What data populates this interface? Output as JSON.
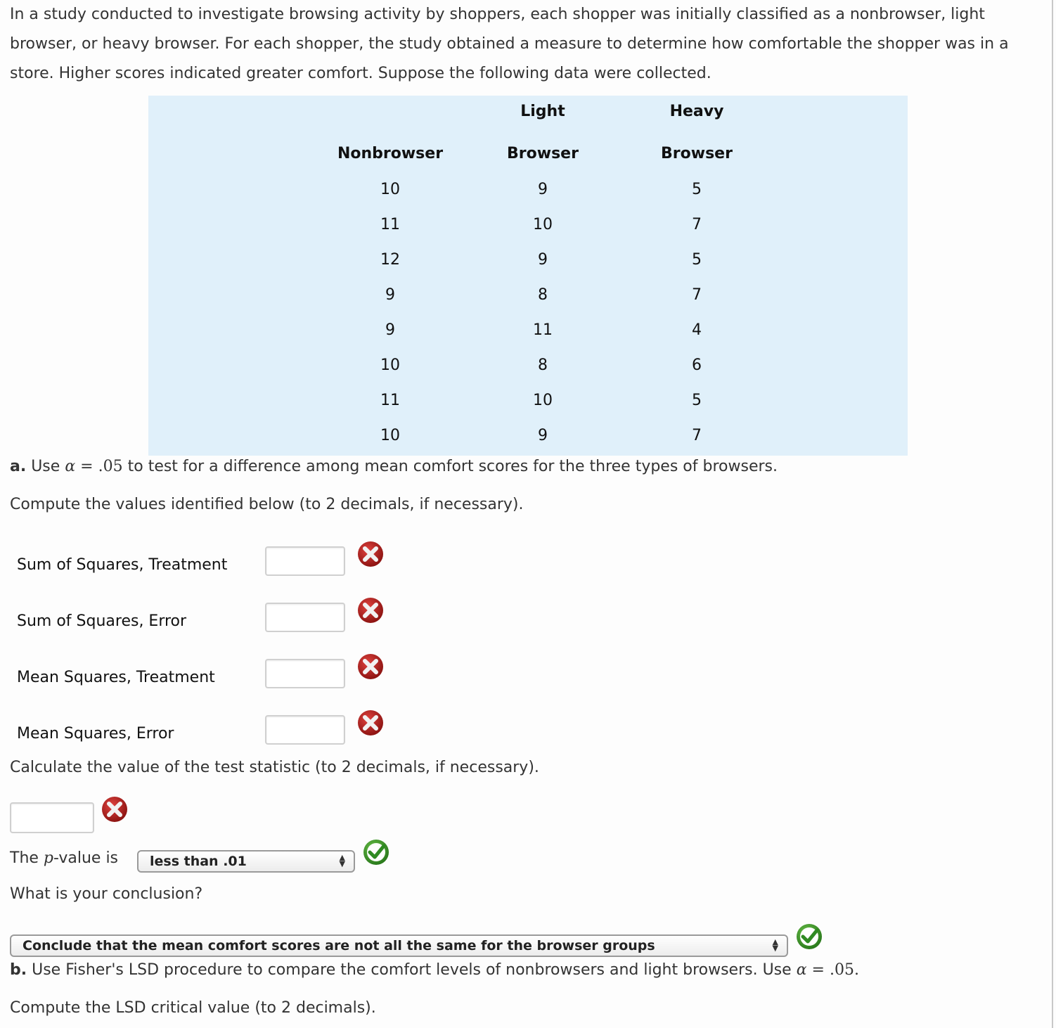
{
  "intro_text": "In a study conducted to investigate browsing activity by shoppers, each shopper was initially classified as a nonbrowser, light browser, or heavy browser. For each shopper, the study obtained a measure to determine how comfortable the shopper was in a store. Higher scores indicated greater comfort. Suppose the following data were collected.",
  "table": {
    "headers_top": [
      "",
      "Light",
      "Heavy"
    ],
    "headers_bottom": [
      "Nonbrowser",
      "Browser",
      "Browser"
    ],
    "rows": [
      [
        "10",
        "9",
        "5"
      ],
      [
        "11",
        "10",
        "7"
      ],
      [
        "12",
        "9",
        "5"
      ],
      [
        "9",
        "8",
        "7"
      ],
      [
        "9",
        "11",
        "4"
      ],
      [
        "10",
        "8",
        "6"
      ],
      [
        "11",
        "10",
        "5"
      ],
      [
        "10",
        "9",
        "7"
      ]
    ]
  },
  "part_a": {
    "label": "a.",
    "text_before": "Use",
    "alpha_symbol": "α",
    "equals": "=",
    "alpha_value": ".05",
    "text_after": "to test for a difference among mean comfort scores for the three types of browsers.",
    "compute_prompt": "Compute the values identified below (to 2 decimals, if necessary).",
    "fields": [
      {
        "label": "Sum of Squares, Treatment",
        "value": "",
        "status": "incorrect"
      },
      {
        "label": "Sum of Squares, Error",
        "value": "",
        "status": "incorrect"
      },
      {
        "label": "Mean Squares, Treatment",
        "value": "",
        "status": "incorrect"
      },
      {
        "label": "Mean Squares, Error",
        "value": "",
        "status": "incorrect"
      }
    ],
    "test_stat_prompt": "Calculate the value of the test statistic (to 2 decimals, if necessary).",
    "test_stat": {
      "value": "",
      "status": "incorrect"
    },
    "pvalue_prefix": "The",
    "pvalue_var": "p",
    "pvalue_suffix": "-value is",
    "pvalue_selected": "less than .01",
    "pvalue_status": "correct",
    "conclusion_prompt": "What is your conclusion?",
    "conclusion_selected": "Conclude that the mean comfort scores are not all the same for the browser groups",
    "conclusion_status": "correct"
  },
  "part_b": {
    "label": "b.",
    "text": "Use Fisher's LSD procedure to compare the comfort levels of nonbrowsers and light browsers. Use",
    "alpha_symbol": "α",
    "equals": "=",
    "alpha_value": ".05.",
    "compute_prompt": "Compute the LSD critical value (to 2 decimals)."
  },
  "colors": {
    "table_bg": "#e0f0fa",
    "incorrect_icon": "#b8201e",
    "correct_icon": "#3a9a2a"
  }
}
